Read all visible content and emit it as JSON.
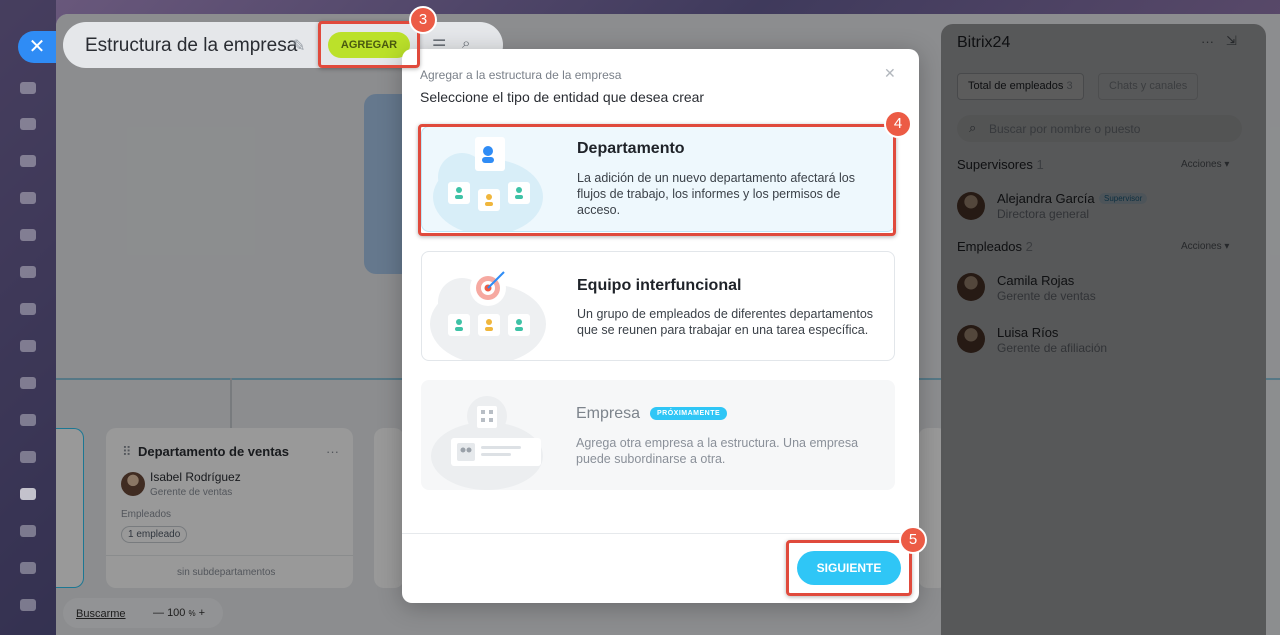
{
  "header": {
    "title": "Estructura de la empresa",
    "add_label": "AGREGAR"
  },
  "canvas": {
    "sales_dept": {
      "title": "Departamento de ventas",
      "manager_name": "Isabel Rodríguez",
      "manager_role": "Gerente de ventas",
      "employees_label": "Empleados",
      "employees_count": "1 empleado",
      "subdepartments": "sin subdepartamentos"
    },
    "bottom": {
      "find_me": "Buscarme",
      "zoom": "100",
      "zoom_unit": "%"
    }
  },
  "right_panel": {
    "title": "Bitrix24",
    "tab_employees": "Total de empleados",
    "tab_employees_count": "3",
    "tab_chats": "Chats y canales",
    "search_placeholder": "Buscar por nombre o puesto",
    "supervisors_label": "Supervisores",
    "supervisors_count": "1",
    "actions_label": "Acciones",
    "supervisor": {
      "name": "Alejandra García",
      "badge": "Supervisor",
      "role": "Directora general"
    },
    "employees_label": "Empleados",
    "employees_count": "2",
    "employees": [
      {
        "name": "Camila Rojas",
        "role": "Gerente de ventas"
      },
      {
        "name": "Luisa Ríos",
        "role": "Gerente de afiliación"
      }
    ]
  },
  "modal": {
    "subtitle": "Agregar a la estructura de la empresa",
    "title": "Seleccione el tipo de entidad que desea crear",
    "options": [
      {
        "title": "Departamento",
        "description": "La adición de un nuevo departamento afectará los flujos de trabajo, los informes y los permisos de acceso."
      },
      {
        "title": "Equipo interfuncional",
        "description": "Un grupo de empleados de diferentes departamentos que se reunen para trabajar en una tarea específica."
      },
      {
        "title": "Empresa",
        "badge": "PRÓXIMAMENTE",
        "description": "Agrega otra empresa a la estructura. Una empresa puede subordinarse a otra."
      }
    ],
    "next_label": "SIGUIENTE"
  },
  "callouts": [
    "3",
    "4",
    "5"
  ],
  "colors": {
    "accent_blue": "#2fc6f6",
    "add_green": "#bbe12a",
    "callout_red": "#e04a3c",
    "selected_bg": "#eef8fd"
  }
}
